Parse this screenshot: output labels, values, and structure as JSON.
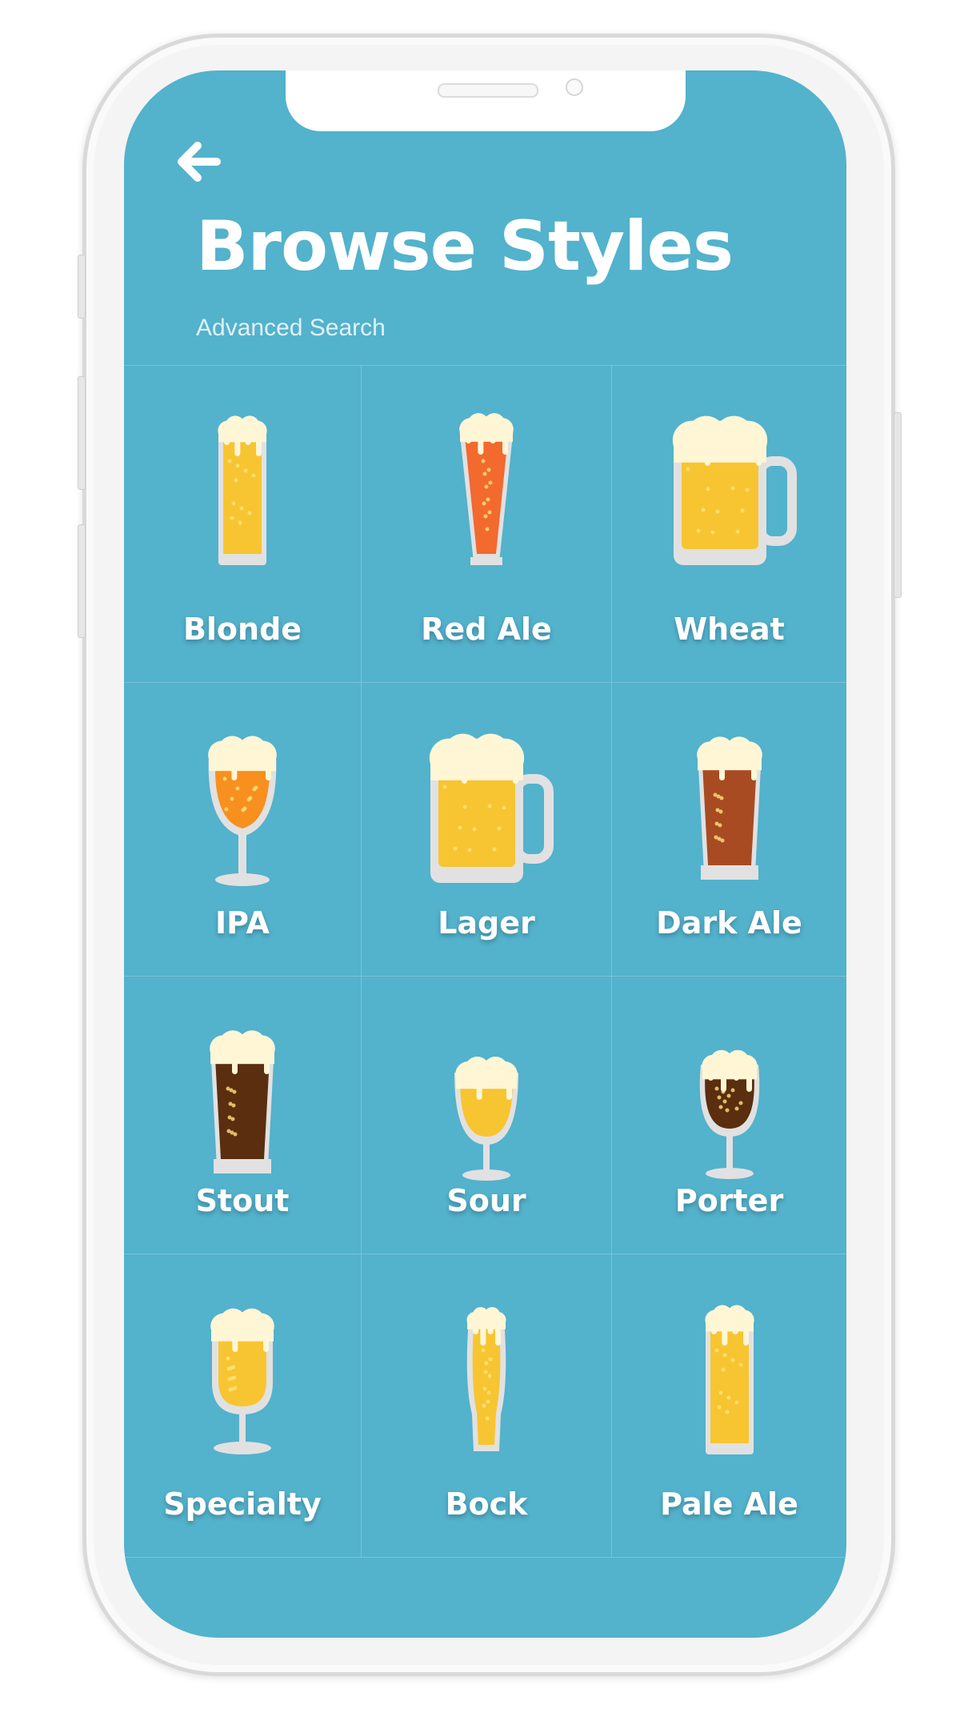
{
  "header": {
    "title": "Browse Styles",
    "advanced_search": "Advanced Search"
  },
  "colors": {
    "background": "#53b2cc",
    "beer_yellow": "#f7c531",
    "foam": "#fff6d6",
    "glass": "#e1e1e1"
  },
  "styles": [
    {
      "label": "Blonde",
      "icon": "tall-glass-icon",
      "liquid": "#f7c531"
    },
    {
      "label": "Red Ale",
      "icon": "pilsner-glass-icon",
      "liquid": "#f26a2e"
    },
    {
      "label": "Wheat",
      "icon": "beer-mug-icon",
      "liquid": "#f7c531"
    },
    {
      "label": "IPA",
      "icon": "goblet-glass-icon",
      "liquid": "#f7901e"
    },
    {
      "label": "Lager",
      "icon": "beer-mug-icon",
      "liquid": "#f7c531"
    },
    {
      "label": "Dark Ale",
      "icon": "pint-glass-icon",
      "liquid": "#a84b23"
    },
    {
      "label": "Stout",
      "icon": "pint-glass-icon",
      "liquid": "#5a2e0e"
    },
    {
      "label": "Sour",
      "icon": "tulip-glass-icon",
      "liquid": "#f7c531"
    },
    {
      "label": "Porter",
      "icon": "snifter-glass-icon",
      "liquid": "#5a2e0e"
    },
    {
      "label": "Specialty",
      "icon": "chalice-glass-icon",
      "liquid": "#f7c531"
    },
    {
      "label": "Bock",
      "icon": "weizen-glass-icon",
      "liquid": "#f7c531"
    },
    {
      "label": "Pale Ale",
      "icon": "tall-glass-icon",
      "liquid": "#f7c531"
    }
  ]
}
